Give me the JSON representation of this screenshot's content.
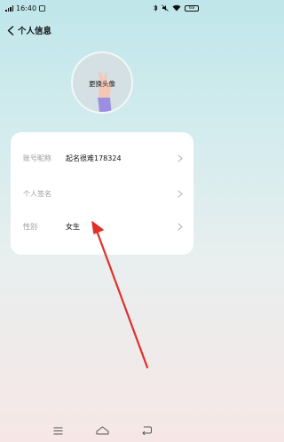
{
  "status_bar": {
    "time": "16:40",
    "battery": "69"
  },
  "header": {
    "title": "个人信息"
  },
  "avatar": {
    "label": "更换头像"
  },
  "profile_rows": [
    {
      "label": "账号昵称",
      "value": "起名很难178324"
    },
    {
      "label": "个人签名",
      "value": ""
    },
    {
      "label": "性别",
      "value": "女生"
    }
  ],
  "colors": {
    "annotation_arrow": "#e0302a",
    "card_bg": "#ffffff",
    "label_gray": "#9a9a9a"
  },
  "icons": {
    "back": "chevron-left-icon",
    "row_arrow": "chevron-right-icon",
    "nav_menu": "menu-icon",
    "nav_home": "home-icon",
    "nav_back": "back-icon"
  }
}
